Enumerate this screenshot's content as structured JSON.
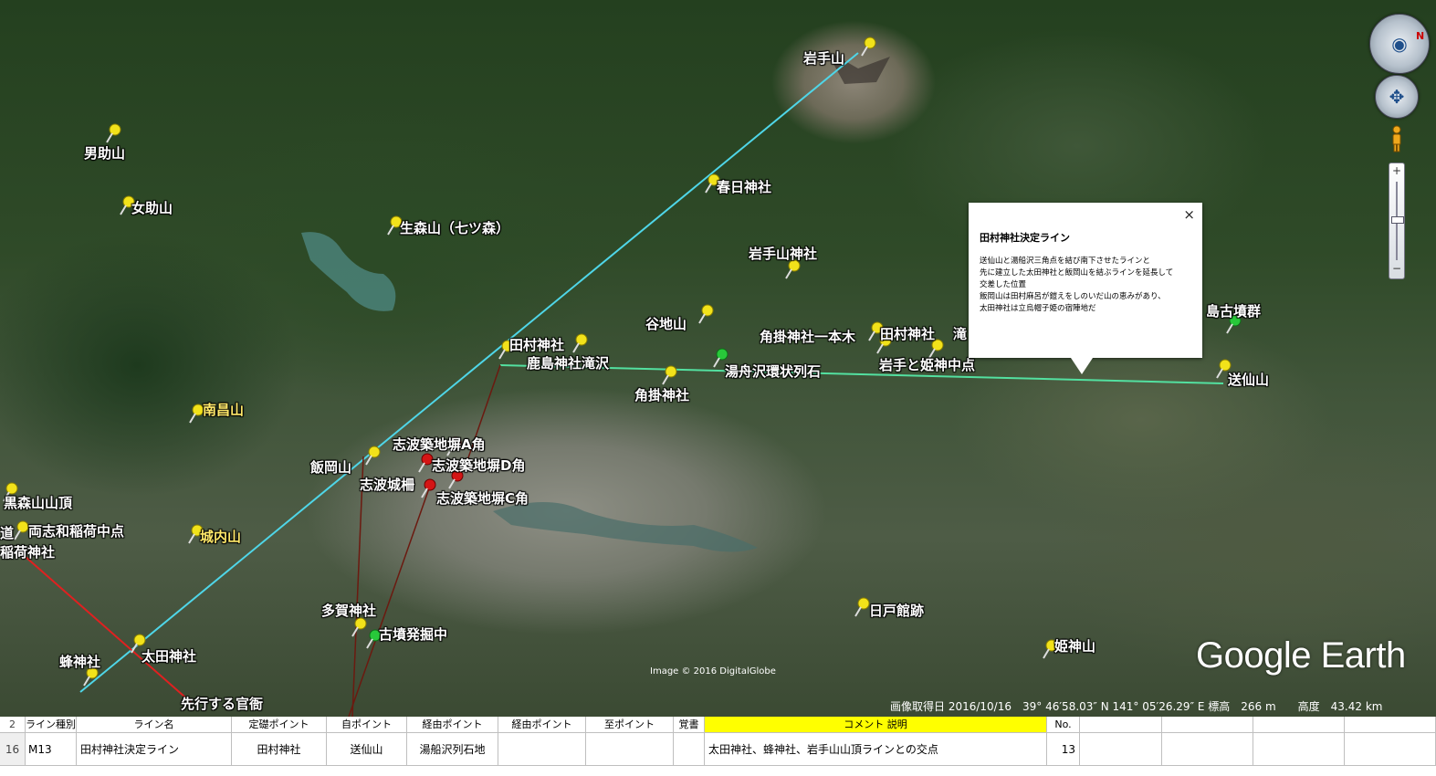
{
  "map": {
    "labels": {
      "iwatesan": "岩手山",
      "kasuga": "春日神社",
      "osukeyama": "男助山",
      "mesukeyama": "女助山",
      "ikimoriyama": "生森山（七ツ森）",
      "iwatesanjinja": "岩手山神社",
      "taniji": "谷地山",
      "kakegake_ippongi": "角掛神社一本木",
      "tamura_right": "田村神社",
      "taki": "滝",
      "tamura_center": "田村神社",
      "kashima": "鹿島神社滝沢",
      "yubune": "湯舟沢環状列石",
      "iwate_hime": "岩手と姫神中点",
      "kakegake": "角掛神社",
      "okuri": "送仙山",
      "kofungun": "島古墳群",
      "minamimasa": "南昌山",
      "shiwa_a": "志波築地塀A角",
      "shiwa_d": "志波築地塀D角",
      "iiokayama": "飯岡山",
      "shiwajo": "志波城柵",
      "shiwa_c": "志波築地塀C角",
      "kuromori": "黒森山山頂",
      "michi": "道",
      "ryoshiwa": "両志和稲荷中点",
      "inari": "稲荷神社",
      "jonai": "城内山",
      "taga": "多賀神社",
      "kofun": "古墳発掘中",
      "hachi": "蜂神社",
      "ota": "太田神社",
      "senko": "先行する官衙",
      "hinoto": "日戸館跡",
      "himekami": "姫神山"
    },
    "credit": "Image © 2016 DigitalGlobe",
    "watermark": "Google Earth",
    "status": "画像取得日 2016/10/16　39° 46′58.03″ N 141° 05′26.29″ E 標高　266 m　　高度　43.42 km"
  },
  "balloon": {
    "title": "田村神社決定ライン",
    "body": [
      "送仙山と湯船沢三角点を結び南下させたラインと",
      "先に建立した太田神社と飯岡山を結ぶラインを延長して",
      "交差した位置",
      "飯岡山は田村麻呂が鎧えをしのいだ山の恵みがあり、",
      "太田神社は立烏帽子姫の宿陣地だ"
    ],
    "close": "×"
  },
  "nav": {
    "north": "N",
    "zoom_in": "+",
    "zoom_out": "−"
  },
  "table": {
    "header": {
      "row_no": "2",
      "cols": [
        "ライン種別",
        "ライン名",
        "定礎ポイント",
        "自ポイント",
        "経由ポイント",
        "経由ポイント",
        "至ポイント",
        "覚書",
        "コメント 説明",
        "No."
      ]
    },
    "row": {
      "row_no": "16",
      "cells": [
        "M13",
        "田村神社決定ライン",
        "田村神社",
        "送仙山",
        "湯船沢列石地",
        "",
        "",
        "",
        "太田神社、蜂神社、岩手山山頂ラインとの交点",
        "13"
      ]
    }
  },
  "colors": {
    "cyan_line": "#4fd6e8",
    "green_line": "#53e0a0",
    "red_line": "#e02020",
    "pin_yellow": "#f2e21a",
    "pin_red": "#d41515",
    "pin_green": "#28c83a",
    "highlight": "#ffff00"
  }
}
